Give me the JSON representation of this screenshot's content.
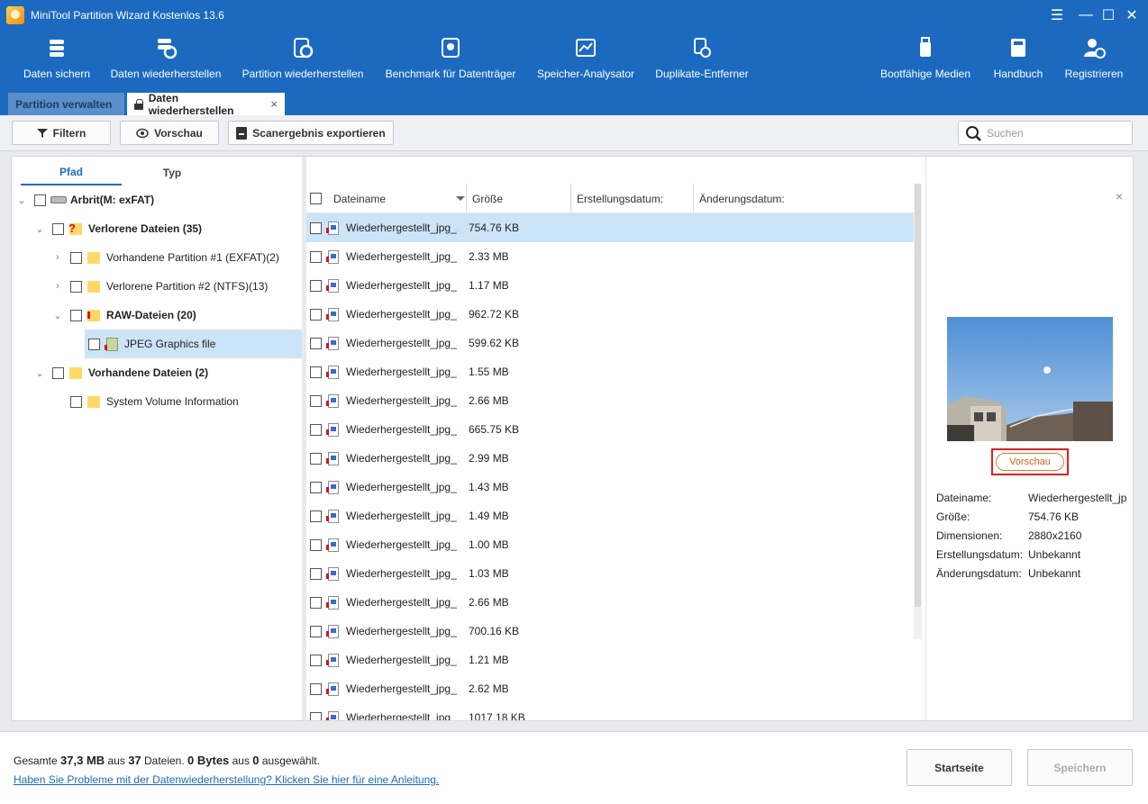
{
  "app": {
    "title": "MiniTool Partition Wizard Kostenlos 13.6"
  },
  "toolbar": {
    "items": [
      {
        "label": "Daten sichern",
        "icon": "database-icon"
      },
      {
        "label": "Daten wiederherstellen",
        "icon": "data-recovery-icon"
      },
      {
        "label": "Partition wiederherstellen",
        "icon": "partition-recovery-icon"
      },
      {
        "label": "Benchmark für Datenträger",
        "icon": "disk-benchmark-icon"
      },
      {
        "label": "Speicher-Analysator",
        "icon": "space-analyzer-icon"
      },
      {
        "label": "Duplikate-Entferner",
        "icon": "duplicate-remover-icon"
      },
      {
        "label": "Bootfähige Medien",
        "icon": "bootable-media-icon"
      },
      {
        "label": "Handbuch",
        "icon": "manual-book-icon"
      },
      {
        "label": "Registrieren",
        "icon": "register-user-icon"
      }
    ]
  },
  "tabs": [
    {
      "label": "Partition verwalten"
    },
    {
      "label": "Daten wiederherstellen",
      "close": "×"
    }
  ],
  "actions": {
    "filter": "Filtern",
    "preview": "Vorschau",
    "export": "Scanergebnis exportieren",
    "search_placeholder": "Suchen"
  },
  "tree": {
    "tabs": [
      "Pfad",
      "Typ"
    ],
    "nodes": [
      {
        "label": "Arbrit(M: exFAT)"
      },
      {
        "label": "Verlorene Dateien (35)"
      },
      {
        "label": "Vorhandene Partition #1 (EXFAT)(2)"
      },
      {
        "label": "Verlorene Partition #2 (NTFS)(13)"
      },
      {
        "label": "RAW-Dateien (20)"
      },
      {
        "label": "JPEG Graphics file"
      },
      {
        "label": "Vorhandene Dateien (2)"
      },
      {
        "label": "System Volume Information"
      }
    ]
  },
  "filelist": {
    "columns": [
      "Dateiname",
      "Größe",
      "Erstellungsdatum:",
      "Änderungsdatum:"
    ],
    "rows": [
      {
        "name": "Wiederhergestellt_jpg_...",
        "size": "754.76 KB"
      },
      {
        "name": "Wiederhergestellt_jpg_...",
        "size": "2.33 MB"
      },
      {
        "name": "Wiederhergestellt_jpg_...",
        "size": "1.17 MB"
      },
      {
        "name": "Wiederhergestellt_jpg_...",
        "size": "962.72 KB"
      },
      {
        "name": "Wiederhergestellt_jpg_...",
        "size": "599.62 KB"
      },
      {
        "name": "Wiederhergestellt_jpg_...",
        "size": "1.55 MB"
      },
      {
        "name": "Wiederhergestellt_jpg_...",
        "size": "2.66 MB"
      },
      {
        "name": "Wiederhergestellt_jpg_...",
        "size": "665.75 KB"
      },
      {
        "name": "Wiederhergestellt_jpg_...",
        "size": "2.99 MB"
      },
      {
        "name": "Wiederhergestellt_jpg_...",
        "size": "1.43 MB"
      },
      {
        "name": "Wiederhergestellt_jpg_...",
        "size": "1.49 MB"
      },
      {
        "name": "Wiederhergestellt_jpg_...",
        "size": "1.00 MB"
      },
      {
        "name": "Wiederhergestellt_jpg_...",
        "size": "1.03 MB"
      },
      {
        "name": "Wiederhergestellt_jpg_...",
        "size": "2.66 MB"
      },
      {
        "name": "Wiederhergestellt_jpg_...",
        "size": "700.16 KB"
      },
      {
        "name": "Wiederhergestellt_jpg_...",
        "size": "1.21 MB"
      },
      {
        "name": "Wiederhergestellt_jpg_...",
        "size": "2.62 MB"
      },
      {
        "name": "Wiederhergestellt_jpg_...",
        "size": "1017.18 KB"
      }
    ]
  },
  "preview": {
    "close": "×",
    "button": "Vorschau",
    "info": [
      {
        "label": "Dateiname:",
        "value": "Wiederhergestellt_jp"
      },
      {
        "label": "Größe:",
        "value": "754.76 KB"
      },
      {
        "label": "Dimensionen:",
        "value": "2880x2160"
      },
      {
        "label": "Erstellungsdatum:",
        "value": "Unbekannt"
      },
      {
        "label": "Änderungsdatum:",
        "value": "Unbekannt"
      }
    ]
  },
  "footer": {
    "t1": "Gesamte ",
    "total_size": "37,3 MB",
    "t2": " aus ",
    "total_files": "37",
    "t3": " Dateien. ",
    "selected_size": "0 Bytes",
    "t4": " aus ",
    "selected_count": "0",
    "t5": " ausgewählt.",
    "help_link": "Haben Sie Probleme mit der Datenwiederherstellung? Klicken Sie hier für eine Anleitung.",
    "home_button": "Startseite",
    "save_button": "Speichern"
  },
  "colors": {
    "accent": "#1b6ac0",
    "selection": "#cce4f7",
    "highlight_border": "#e02020"
  }
}
